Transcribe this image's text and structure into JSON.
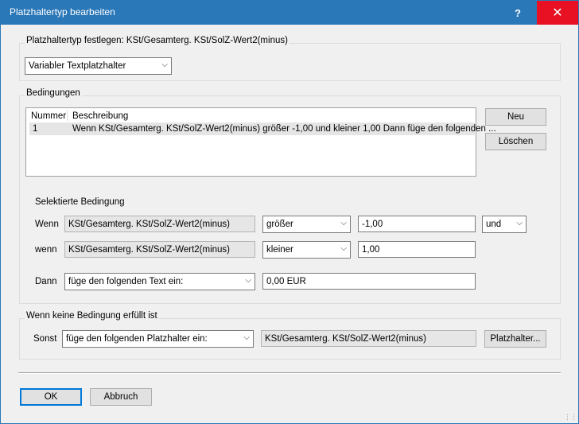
{
  "window": {
    "title": "Platzhaltertyp bearbeiten",
    "help_label": "?",
    "close_label": "✕"
  },
  "define": {
    "label": "Platzhaltertyp festlegen: KSt/Gesamterg. KSt/SolZ-Wert2(minus)",
    "type_value": "Variabler Textplatzhalter"
  },
  "conditions": {
    "group_label": "Bedingungen",
    "columns": [
      "Nummer",
      "Beschreibung"
    ],
    "rows": [
      {
        "nummer": "1",
        "beschreibung": "Wenn KSt/Gesamterg. KSt/SolZ-Wert2(minus) größer -1,00 und kleiner 1,00 Dann füge den folgenden ..."
      }
    ],
    "new_label": "Neu",
    "delete_label": "Löschen"
  },
  "selected": {
    "heading": "Selektierte Bedingung",
    "wenn1": {
      "label": "Wenn",
      "field": "KSt/Gesamterg. KSt/SolZ-Wert2(minus)",
      "operator": "größer",
      "value": "-1,00",
      "connector": "und"
    },
    "wenn2": {
      "label": "wenn",
      "field": "KSt/Gesamterg. KSt/SolZ-Wert2(minus)",
      "operator": "kleiner",
      "value": "1,00"
    },
    "dann": {
      "label": "Dann",
      "action": "füge den folgenden Text ein:",
      "value": "0,00 EUR"
    }
  },
  "else": {
    "group_label": "Wenn keine Bedingung erfüllt ist",
    "label": "Sonst",
    "action": "füge den folgenden Platzhalter ein:",
    "placeholder": "KSt/Gesamterg. KSt/SolZ-Wert2(minus)",
    "button_label": "Platzhalter..."
  },
  "footer": {
    "ok_label": "OK",
    "cancel_label": "Abbruch"
  },
  "icons": {
    "dropdown": "chevron-down-icon",
    "grip": "resize-grip-icon"
  }
}
